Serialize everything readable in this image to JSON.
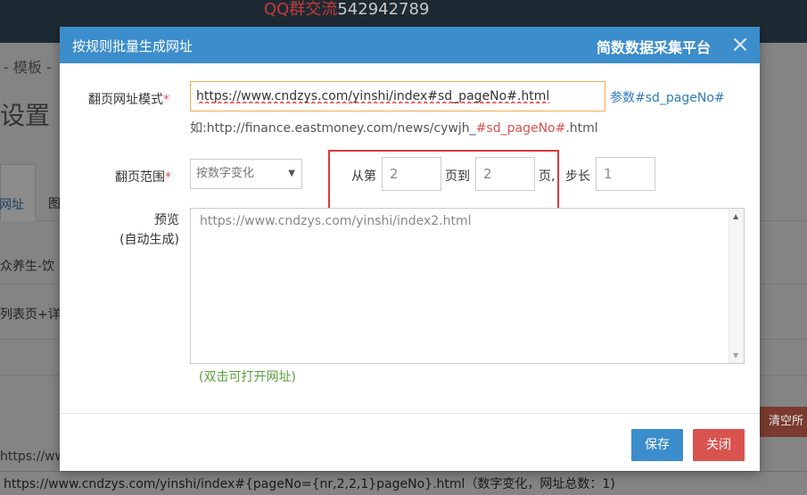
{
  "background": {
    "qq_group_label": "QQ群交流",
    "qq_number": "542942789",
    "breadcrumb": "- 模板 -",
    "title": "设置",
    "tab1": "网址",
    "tab2": "图",
    "row1": "众养生-饮",
    "row2": "列表页+详",
    "clear_button": "清空所",
    "url_fragment": "https://ww",
    "status_line": "https://www.cndzys.com/yinshi/index#{pageNo={nr,2,2,1}pageNo}.html（数字变化，网址总数：1)"
  },
  "modal": {
    "title": "按规则批量生成网址",
    "brand": "简数数据采集平台",
    "close_icon": "×",
    "url_pattern": {
      "label": "翻页网址模式",
      "required_mark": "*",
      "value": "https://www.cndzys.com/yinshi/index#sd_pageNo#.html",
      "param_link": "参数#sd_pageNo#",
      "example_prefix": "如:http://finance.eastmoney.com/news/cywjh_",
      "example_param": "#sd_pageNo#",
      "example_suffix": ".html"
    },
    "range": {
      "label": "翻页范围",
      "required_mark": "*",
      "mode_selected": "按数字变化",
      "from_label": "从第",
      "from_value": "2",
      "to_label": "页到",
      "to_value": "2",
      "page_suffix": "页,",
      "step_label": "步长",
      "step_value": "1"
    },
    "preview": {
      "label_line1": "预览",
      "label_line2": "(自动生成)",
      "content": "https://www.cndzys.com/yinshi/index2.html",
      "hint": "(双击可打开网址)"
    },
    "buttons": {
      "save": "保存",
      "close": "关闭"
    }
  },
  "colors": {
    "header_blue": "#3c8dcc",
    "danger_red": "#d9534f",
    "annotation_red": "#e03a3a",
    "hint_green": "#5a9e3a"
  }
}
